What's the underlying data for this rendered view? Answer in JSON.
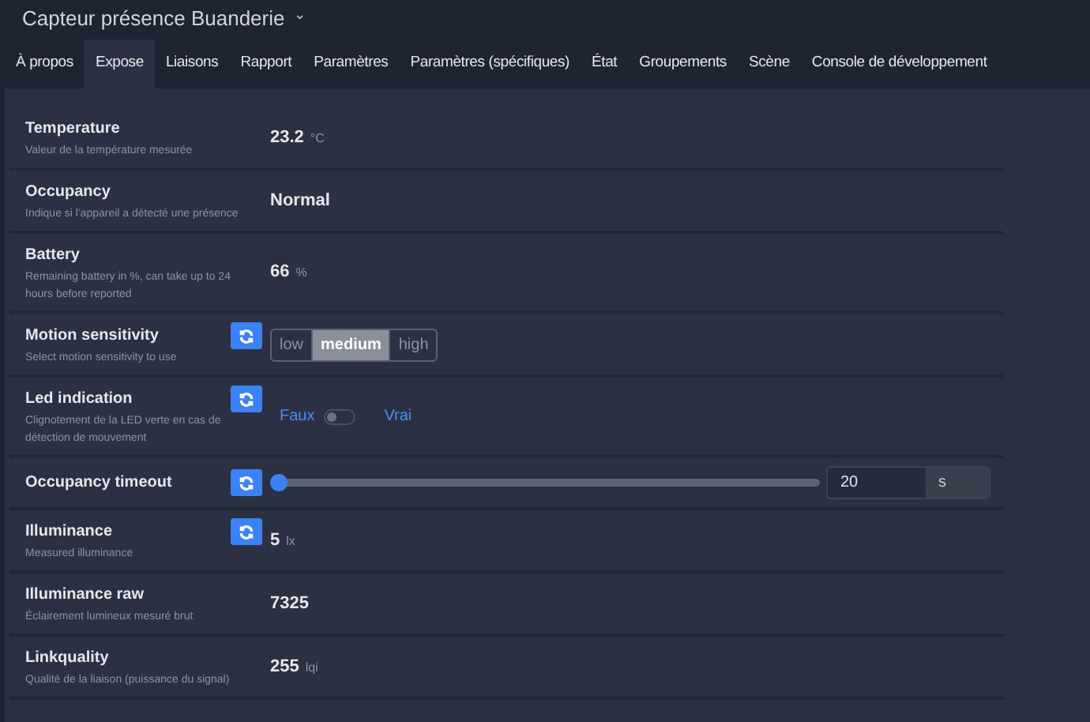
{
  "window": {
    "title": "Capteur présence Buanderie",
    "dropdown": "⌄"
  },
  "tabs": [
    {
      "label": "À propos",
      "selected": false
    },
    {
      "label": "Expose",
      "selected": true
    },
    {
      "label": "Liaisons",
      "selected": false
    },
    {
      "label": "Rapport",
      "selected": false
    },
    {
      "label": "Paramètres",
      "selected": false
    },
    {
      "label": "Paramètres (spécifiques)",
      "selected": false
    },
    {
      "label": "État",
      "selected": false
    },
    {
      "label": "Groupements",
      "selected": false
    },
    {
      "label": "Scène",
      "selected": false
    },
    {
      "label": "Console de développement",
      "selected": false
    }
  ],
  "rows": [
    {
      "kind": "value",
      "name": "Temperature",
      "description": "Valeur de la température mesurée",
      "refresh": false,
      "value": "23.2",
      "unit": "°C"
    },
    {
      "kind": "text",
      "name": "Occupancy",
      "description": "Indique si l'appareil a détecté une présence",
      "refresh": false,
      "value": "Normal"
    },
    {
      "kind": "value",
      "name": "Battery",
      "description": "Remaining battery in %, can take up to 24 hours before reported",
      "refresh": false,
      "value": "66",
      "unit": "%"
    },
    {
      "kind": "enum",
      "name": "Motion sensitivity",
      "description": "Select motion sensitivity to use",
      "refresh": true,
      "options": [
        {
          "label": "low",
          "selected": false
        },
        {
          "label": "medium",
          "selected": true
        },
        {
          "label": "high",
          "selected": false
        }
      ]
    },
    {
      "kind": "binary",
      "name": "Led indication",
      "description": "Clignotement de la LED verte en cas de détection de mouvement",
      "refresh": true,
      "off_label": "Faux",
      "on_label": "Vrai",
      "on": false
    },
    {
      "kind": "range",
      "name": "Occupancy timeout",
      "refresh": true,
      "level": 0,
      "value": "20",
      "unit": "s"
    },
    {
      "kind": "value",
      "name": "Illuminance",
      "description": "Measured illuminance",
      "refresh": true,
      "value": "5",
      "unit": "lx"
    },
    {
      "kind": "text",
      "name": "Illuminance raw",
      "description": "Éclairement lumineux mesuré brut",
      "refresh": false,
      "value": "7325"
    },
    {
      "kind": "value",
      "name": "Linkquality",
      "description": "Qualité de la liaison (puissance du signal)",
      "refresh": false,
      "value": "255",
      "unit": "lqi"
    }
  ]
}
